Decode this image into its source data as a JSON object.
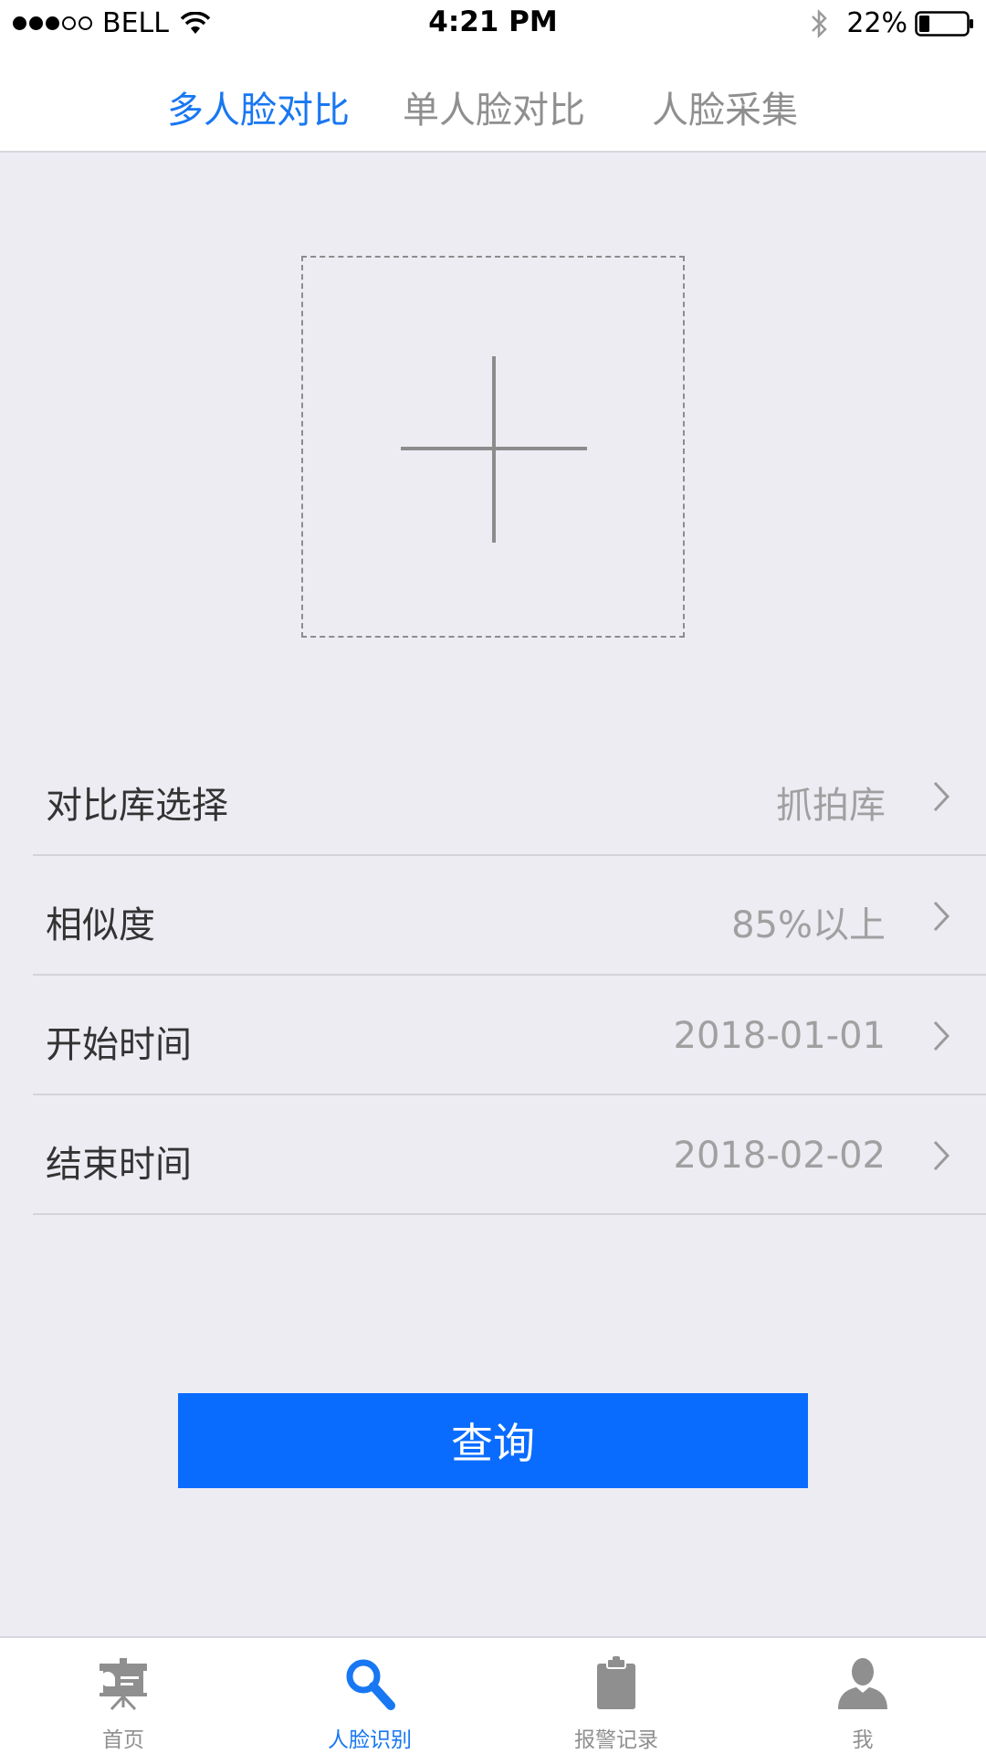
{
  "status_bar": {
    "carrier": "BELL",
    "time": "4:21 PM",
    "battery": "22%",
    "signal_bars_filled": 3,
    "signal_bars_total": 5
  },
  "tabs": [
    {
      "label": "多人脸对比",
      "active": true
    },
    {
      "label": "单人脸对比",
      "active": false
    },
    {
      "label": "人脸采集",
      "active": false
    }
  ],
  "upload": {
    "icon": "plus-icon"
  },
  "form": [
    {
      "label": "对比库选择",
      "value": "抓拍库"
    },
    {
      "label": "相似度",
      "value": "85%以上"
    },
    {
      "label": "开始时间",
      "value": "2018-01-01"
    },
    {
      "label": "结束时间",
      "value": "2018-02-02"
    }
  ],
  "query_button": {
    "label": "查询"
  },
  "bottom_nav": [
    {
      "label": "首页",
      "icon": "presentation-board-icon",
      "active": false
    },
    {
      "label": "人脸识别",
      "icon": "search-icon",
      "active": true
    },
    {
      "label": "报警记录",
      "icon": "clipboard-icon",
      "active": false
    },
    {
      "label": "我",
      "icon": "user-icon",
      "active": false
    }
  ],
  "colors": {
    "accent": "#1877f2",
    "button": "#0a6cff",
    "background": "#edecf3",
    "inactive": "#8f8f8f"
  }
}
